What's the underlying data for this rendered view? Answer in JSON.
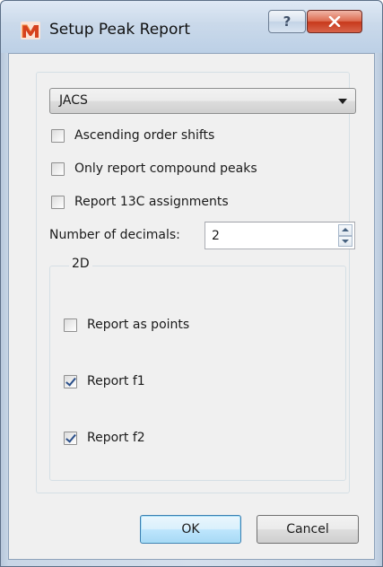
{
  "window": {
    "title": "Setup Peak Report"
  },
  "titlebar": {
    "help_label": "?",
    "help_icon": "question-icon",
    "close_icon": "close-icon"
  },
  "format": {
    "selected": "JACS"
  },
  "options": {
    "ascending": {
      "label": "Ascending order shifts",
      "checked": false
    },
    "compound": {
      "label": "Only report compound peaks",
      "checked": false
    },
    "c13": {
      "label": "Report 13C assignments",
      "checked": false
    }
  },
  "decimals": {
    "label": "Number of decimals:",
    "value": "2"
  },
  "group2d": {
    "title": "2D",
    "points": {
      "label": "Report as points",
      "checked": false
    },
    "f1": {
      "label": "Report f1",
      "checked": true
    },
    "f2": {
      "label": "Report f2",
      "checked": true
    }
  },
  "buttons": {
    "ok": "OK",
    "cancel": "Cancel"
  },
  "colors": {
    "close_button": "#c7381b",
    "default_button_border": "#3c7fb1",
    "check_mark": "#2a4f8a"
  }
}
